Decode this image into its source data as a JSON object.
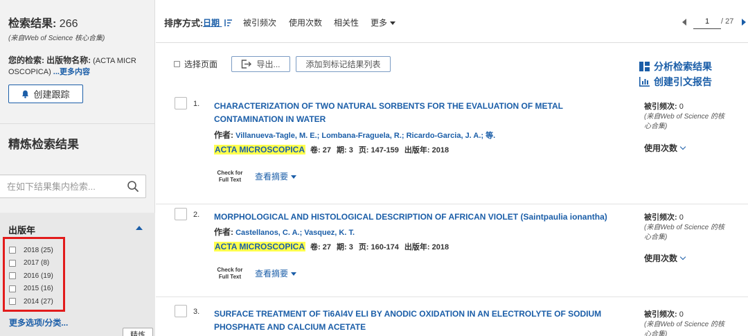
{
  "sidebar": {
    "results_label": "检索结果:",
    "results_count": "266",
    "results_source": "(来自Web of Science 核心合集)",
    "query_label": "您的检索:",
    "query_text": "出版物名称:",
    "query_value_line1": "(ACTA MICR",
    "query_value_line2": "OSCOPICA)",
    "more_content": "...更多内容",
    "create_alert": "创建跟踪",
    "refine_title": "精炼检索结果",
    "search_placeholder": "在如下结果集内检索...",
    "year_heading": "出版年",
    "years": [
      {
        "label": "2018 (25)"
      },
      {
        "label": "2017 (8)"
      },
      {
        "label": "2016 (19)"
      },
      {
        "label": "2015 (16)"
      },
      {
        "label": "2014 (27)"
      }
    ],
    "more_options": "更多选项/分类...",
    "refine_button": "精炼"
  },
  "topbar": {
    "sort_label": "排序方式:",
    "sort_date": "日期",
    "sort_citations": "被引频次",
    "sort_usage": "使用次数",
    "sort_relevance": "相关性",
    "sort_more": "更多",
    "page_current": "1",
    "page_total": "/ 27"
  },
  "toolbar": {
    "select_page": "选择页面",
    "export": "导出...",
    "add_marked": "添加到标记结果列表",
    "analyze": "分析检索结果",
    "citation_report": "创建引文报告"
  },
  "records": [
    {
      "num": "1.",
      "title": "CHARACTERIZATION OF TWO NATURAL SORBENTS FOR THE EVALUATION OF METAL CONTAMINATION IN WATER",
      "authors_label": "作者:",
      "authors": "Villanueva-Tagle, M. E.; Lombana-Fraguela, R.; Ricardo-Garcia, J. A.; 等.",
      "journal": "ACTA MICROSCOPICA",
      "volume": "卷: 27",
      "issue": "期: 3",
      "pages": "页: 147-159",
      "year": "出版年: 2018",
      "cft_line1": "Check for",
      "cft_line2": "Full Text",
      "abstract": "查看摘要",
      "cited_label": "被引频次:",
      "cited_value": "0",
      "cited_source_line1": "(来自Web of Science 的核",
      "cited_source_line2": "心合集)",
      "usage": "使用次数"
    },
    {
      "num": "2.",
      "title": "MORPHOLOGICAL AND HISTOLOGICAL DESCRIPTION OF AFRICAN VIOLET (Saintpaulia ionantha)",
      "authors_label": "作者:",
      "authors": "Castellanos, C. A.; Vasquez, K. T.",
      "journal": "ACTA MICROSCOPICA",
      "volume": "卷: 27",
      "issue": "期: 3",
      "pages": "页: 160-174",
      "year": "出版年: 2018",
      "cft_line1": "Check for",
      "cft_line2": "Full Text",
      "abstract": "查看摘要",
      "cited_label": "被引频次:",
      "cited_value": "0",
      "cited_source_line1": "(来自Web of Science 的核",
      "cited_source_line2": "心合集)",
      "usage": "使用次数"
    },
    {
      "num": "3.",
      "title": "SURFACE TREATMENT OF Ti6Al4V ELI BY ANODIC OXIDATION IN AN ELECTROLYTE OF SODIUM PHOSPHATE AND CALCIUM ACETATE",
      "cited_label": "被引频次:",
      "cited_value": "0",
      "cited_source_line1": "(来自Web of Science 的核",
      "cited_source_line2": "心合集)"
    }
  ],
  "colors": {
    "link_blue": "#1b5ea8",
    "highlight_yellow": "#ffff4d",
    "annotation_red": "#e21b1b"
  }
}
